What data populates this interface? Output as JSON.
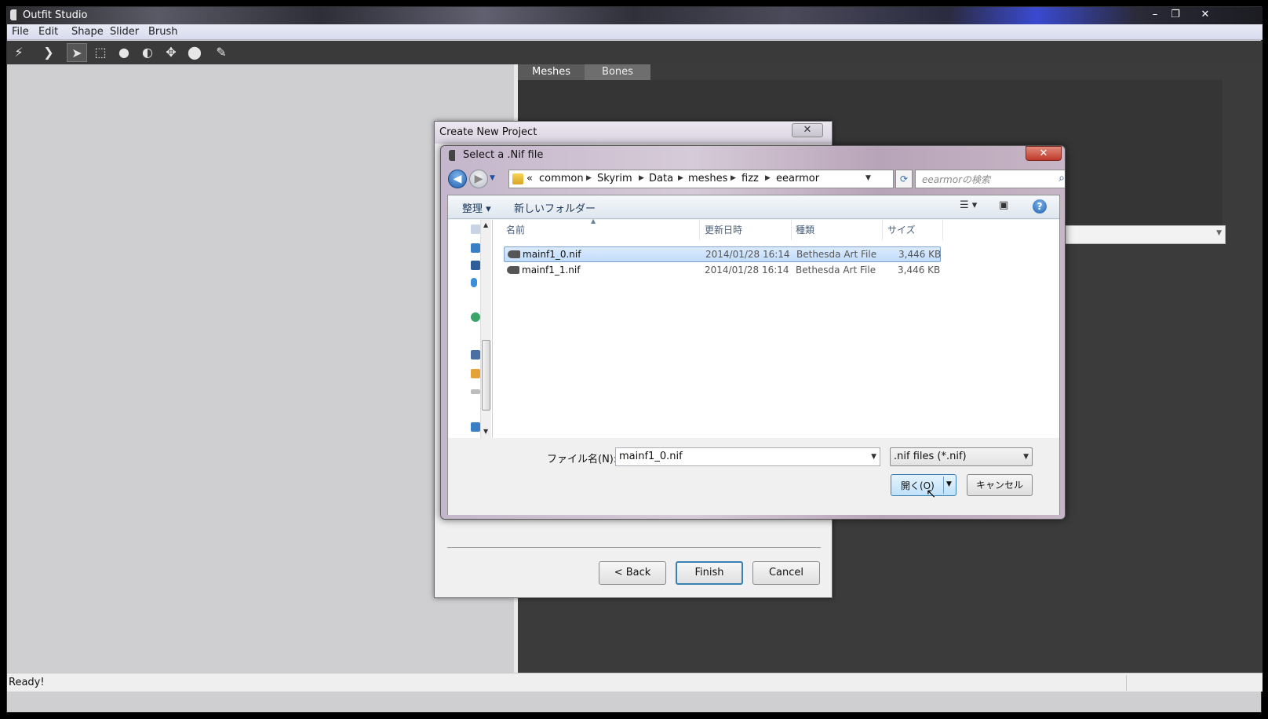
{
  "app": {
    "title": "Outfit Studio",
    "menu": [
      "File",
      "Edit",
      "Shape",
      "Slider",
      "Brush"
    ],
    "window_buttons": {
      "minimize": "–",
      "restore": "❐",
      "close": "✕"
    },
    "tabs": [
      "Meshes",
      "Bones"
    ],
    "status": "Ready!"
  },
  "create_project": {
    "title": "Create New Project",
    "close": "✕",
    "back": "< Back",
    "finish": "Finish",
    "cancel": "Cancel"
  },
  "nif_dialog": {
    "title": "Select a .Nif file",
    "close": "✕",
    "nav_back": "◀",
    "nav_forward": "▶",
    "breadcrumb": [
      "«",
      "common",
      "Skyrim",
      "Data",
      "meshes",
      "fizz",
      "eearmor"
    ],
    "search_placeholder": "eearmorの検索",
    "organize": "整理 ▾",
    "new_folder": "新しいフォルダー",
    "help": "?",
    "columns": {
      "name": "名前",
      "date": "更新日時",
      "type": "種類",
      "size": "サイズ"
    },
    "files": [
      {
        "name": "mainf1_0.nif",
        "date": "2014/01/28 16:14",
        "type": "Bethesda Art File",
        "size": "3,446 KB",
        "selected": true
      },
      {
        "name": "mainf1_1.nif",
        "date": "2014/01/28 16:14",
        "type": "Bethesda Art File",
        "size": "3,446 KB",
        "selected": false
      }
    ],
    "filename_label": "ファイル名(N):",
    "filename_value": "mainf1_0.nif",
    "filetype_value": ".nif files (*.nif)",
    "open_button": "開く(O)",
    "cancel_button": "キャンセル"
  },
  "icons": {
    "tools": [
      "brush-select-icon",
      "mask-icon",
      "inflate-icon",
      "deflate-icon",
      "move-icon",
      "smooth-icon",
      "weight-icon"
    ]
  }
}
